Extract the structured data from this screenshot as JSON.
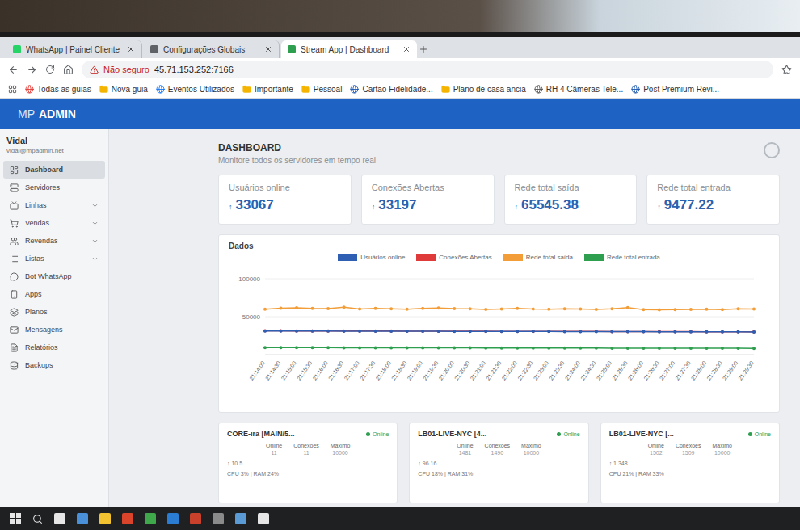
{
  "browser": {
    "tabs": [
      {
        "label": "WhatsApp | Painel Cliente",
        "selected": false
      },
      {
        "label": "Configurações Globais",
        "selected": false
      },
      {
        "label": "Stream App | Dashboard",
        "selected": true
      }
    ],
    "address": {
      "warning": "Não seguro",
      "url": "45.71.153.252:7166"
    },
    "bookmarks": [
      {
        "label": "Todas as guias",
        "color": "#e53935"
      },
      {
        "label": "Nova guia",
        "color": "#f4b400"
      },
      {
        "label": "Eventos Utilizados",
        "color": "#1877f2"
      },
      {
        "label": "Importante",
        "color": "#f4b400"
      },
      {
        "label": "Pessoal",
        "color": "#f4b400"
      },
      {
        "label": "Cartão Fidelidade...",
        "color": "#1a56b0"
      },
      {
        "label": "Plano de casa ancia",
        "color": "#f4b400"
      },
      {
        "label": "RH 4 Câmeras Tele...",
        "color": "#555555"
      },
      {
        "label": "Post Premium Revi...",
        "color": "#1a56b0"
      }
    ]
  },
  "header": {
    "brand_prefix": "MP",
    "brand_name": "ADMIN"
  },
  "sidebar": {
    "user": {
      "name": "Vidal",
      "email": "vidal@mpadmin.net"
    },
    "items": [
      {
        "label": "Dashboard",
        "selected": true,
        "kind": "link",
        "expanded": false
      },
      {
        "label": "Servidores",
        "selected": false,
        "kind": "link",
        "expanded": false
      },
      {
        "label": "Linhas",
        "selected": false,
        "kind": "group",
        "expanded": false
      },
      {
        "label": "Vendas",
        "selected": false,
        "kind": "group",
        "expanded": false
      },
      {
        "label": "Revendas",
        "selected": false,
        "kind": "group",
        "expanded": false
      },
      {
        "label": "Listas",
        "selected": false,
        "kind": "group",
        "expanded": false
      },
      {
        "label": "Bot WhatsApp",
        "selected": false,
        "kind": "link",
        "expanded": false
      },
      {
        "label": "Apps",
        "selected": false,
        "kind": "link",
        "expanded": false
      },
      {
        "label": "Planos",
        "selected": false,
        "kind": "link",
        "expanded": false
      },
      {
        "label": "Mensagens",
        "selected": false,
        "kind": "link",
        "expanded": false
      },
      {
        "label": "Relatórios",
        "selected": false,
        "kind": "link",
        "expanded": false
      },
      {
        "label": "Backups",
        "selected": false,
        "kind": "link",
        "expanded": false
      }
    ]
  },
  "page": {
    "title": "DASHBOARD",
    "subtitle": "Monitore todos os servidores em tempo real"
  },
  "stats": [
    {
      "label": "Usuários online",
      "arrow": "↑",
      "value": "33067"
    },
    {
      "label": "Conexões Abertas",
      "arrow": "↑",
      "value": "33197"
    },
    {
      "label": "Rede total saída",
      "arrow": "↑",
      "value": "65545.38"
    },
    {
      "label": "Rede total entrada",
      "arrow": "↑",
      "value": "9477.22"
    }
  ],
  "chart": {
    "title": "Dados",
    "ticks": [
      "100000",
      "50000"
    ],
    "labels": [
      "21:14:00",
      "21:14:30",
      "21:15:00",
      "21:15:30",
      "21:16:00",
      "21:16:30",
      "21:17:00",
      "21:17:30",
      "21:18:00",
      "21:18:30",
      "21:19:00",
      "21:19:30",
      "21:20:00",
      "21:20:30",
      "21:21:00",
      "21:21:30",
      "21:22:00",
      "21:22:30",
      "21:23:00",
      "21:23:30",
      "21:24:00",
      "21:24:30",
      "21:25:00",
      "21:25:30",
      "21:26:00",
      "21:26:30",
      "21:27:00",
      "21:27:30",
      "21:28:00",
      "21:28:30",
      "21:29:00",
      "21:29:30"
    ],
    "series": [
      {
        "name": "Usuários online",
        "color": "#2f5fb3",
        "values": [
          31200,
          31150,
          31100,
          31080,
          31020,
          30980,
          30950,
          30900,
          30860,
          30820,
          30780,
          30740,
          30700,
          30660,
          30620,
          30580,
          30540,
          30500,
          30460,
          30420,
          30380,
          30340,
          30300,
          30260,
          30220,
          30180,
          30140,
          30100,
          30050,
          30000,
          29950,
          29900
        ]
      },
      {
        "name": "Conexões Abertas",
        "color": "#e03b3b",
        "values": [
          31330,
          31280,
          31230,
          31210,
          31150,
          31110,
          31080,
          31030,
          30990,
          30950,
          30910,
          30870,
          30830,
          30790,
          30750,
          30710,
          30670,
          30630,
          30590,
          30550,
          30510,
          30470,
          30430,
          30390,
          30350,
          30310,
          30270,
          30230,
          30180,
          30130,
          30080,
          30030
        ]
      },
      {
        "name": "Rede total saída",
        "color": "#f29d38",
        "values": [
          59800,
          61200,
          61600,
          60900,
          60700,
          62400,
          60100,
          60800,
          60500,
          59800,
          60900,
          61400,
          60600,
          60300,
          59700,
          60200,
          60800,
          60100,
          59900,
          60400,
          60000,
          59500,
          60300,
          62000,
          59300,
          59100,
          59400,
          59600,
          59800,
          59200,
          60400,
          60200
        ]
      },
      {
        "name": "Rede total entrada",
        "color": "#2e9e4f",
        "values": [
          9300,
          9270,
          9240,
          9210,
          9180,
          9150,
          9120,
          9090,
          9060,
          9030,
          9000,
          8970,
          8940,
          8910,
          8880,
          8850,
          8820,
          8790,
          8760,
          8730,
          8700,
          8670,
          8640,
          8610,
          8580,
          8550,
          8520,
          8490,
          8460,
          8430,
          8400,
          8370
        ]
      }
    ]
  },
  "servers": [
    {
      "name": "CORE-ira [MAIN/5...",
      "status": "Online",
      "color": "#2e9e4f",
      "stats": [
        {
          "label": "Online",
          "value": "11"
        },
        {
          "label": "Conexões",
          "value": "11"
        },
        {
          "label": "Máximo",
          "value": "10000"
        }
      ],
      "lines": [
        "↑ 10.5",
        "CPU 3% | RAM 24%"
      ]
    },
    {
      "name": "LB01-LIVE-NYC [4...",
      "status": "Online",
      "color": "#2e9e4f",
      "stats": [
        {
          "label": "Online",
          "value": "1481"
        },
        {
          "label": "Conexões",
          "value": "1490"
        },
        {
          "label": "Máximo",
          "value": "10000"
        }
      ],
      "lines": [
        "↑ 96.16",
        "CPU 18% | RAM 31%"
      ]
    },
    {
      "name": "LB01-LIVE-NYC [...",
      "status": "Online",
      "color": "#2e9e4f",
      "stats": [
        {
          "label": "Online",
          "value": "1502"
        },
        {
          "label": "Conexões",
          "value": "1509"
        },
        {
          "label": "Máximo",
          "value": "10000"
        }
      ],
      "lines": [
        "↑ 1.348",
        "CPU 21% | RAM 33%"
      ]
    }
  ]
}
